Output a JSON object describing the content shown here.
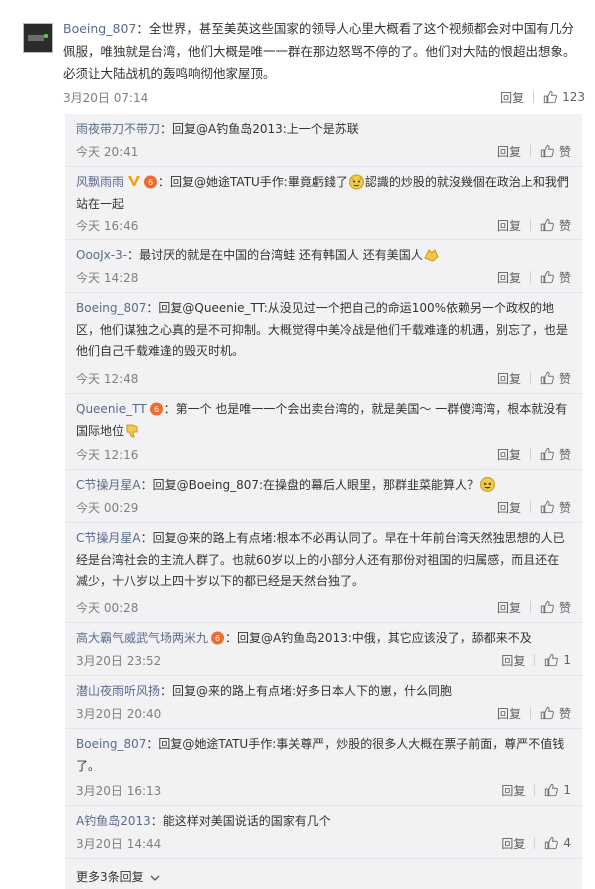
{
  "main_comment": {
    "username": "Boeing_807",
    "text": "：全世界，甚至美英这些国家的领导人心里大概看了这个视频都会对中国有几分佩服，唯独就是台湾，他们大概是唯一一群在那边怒骂不停的了。他们对大陆的恨超出想象。必须让大陆战机的轰鸣响彻他家屋顶。",
    "time": "3月20日 07:14",
    "reply_label": "回复",
    "like_count": "123"
  },
  "replies": [
    {
      "username": "雨夜带刀不带刀",
      "text": "：回复@A钓鱼岛2013:上一个是苏联",
      "time": "今天 20:41",
      "reply_label": "回复",
      "like_label": "赞"
    },
    {
      "username": "风飘雨雨",
      "text": "：回复@她途TATU手作:畢竟虧錢了",
      "text2": "認識的炒股的就沒幾個在政治上和我們站在一起",
      "time": "今天 16:46",
      "reply_label": "回复",
      "like_label": "赞"
    },
    {
      "username": "OooJx-3-",
      "text": "：最讨厌的就是在中国的台湾蛙 还有韩国人 还有美国人",
      "time": "今天 14:28",
      "reply_label": "回复",
      "like_label": "赞"
    },
    {
      "username": "Boeing_807",
      "text": "：回复@Queenie_TT:从没见过一个把自己的命运100%依赖另一个政权的地区，他们谋独之心真的是不可抑制。大概觉得中美冷战是他们千载难逢的机遇，别忘了，也是他们自己千载难逢的毁灭时机。",
      "time": "今天 12:48",
      "reply_label": "回复",
      "like_label": "赞"
    },
    {
      "username": "Queenie_TT",
      "text": "：第一个 也是唯一一个会出卖台湾的，就是美国～ 一群傻湾湾，根本就没有国际地位",
      "time": "今天 12:16",
      "reply_label": "回复",
      "like_label": "赞"
    },
    {
      "username": "C节操月星A",
      "text": "：回复@Boeing_807:在操盘的幕后人眼里，那群韭菜能算人？",
      "time": "今天 00:29",
      "reply_label": "回复",
      "like_label": "赞"
    },
    {
      "username": "C节操月星A",
      "text": "：回复@来的路上有点堵:根本不必再认同了。早在十年前台湾天然独思想的人已经是台湾社会的主流人群了。也就60岁以上的小部分人还有那份对祖国的归属感，而且还在减少，十八岁以上四十岁以下的都已经是天然台独了。",
      "time": "今天 00:28",
      "reply_label": "回复",
      "like_label": "赞"
    },
    {
      "username": "高大霸气威武气场两米九",
      "text": "：回复@A钓鱼岛2013:中俄，其它应该没了，舔都来不及",
      "time": "3月20日 23:52",
      "reply_label": "回复",
      "like_label": "1"
    },
    {
      "username": "潜山夜雨听风扬",
      "text": "：回复@来的路上有点堵:好多日本人下的崽，什么同胞",
      "time": "3月20日 20:40",
      "reply_label": "回复",
      "like_label": "赞"
    },
    {
      "username": "Boeing_807",
      "text": "：回复@她途TATU手作:事关尊严，炒股的很多人大概在票子前面，尊严不值钱了。",
      "time": "3月20日 16:13",
      "reply_label": "回复",
      "like_label": "1"
    },
    {
      "username": "A钓鱼岛2013",
      "text": "：能这样对美国说话的国家有几个",
      "time": "3月20日 14:44",
      "reply_label": "回复",
      "like_label": "4"
    }
  ],
  "more_replies": "更多3条回复",
  "icons": {
    "like": "thumbs-up-icon",
    "vip": "vip-v-icon",
    "badge": "member-badge-icon",
    "expand": "chevron-down-icon"
  },
  "colors": {
    "username": "#5a6b8c",
    "reply_bg": "#f2f2f5",
    "meta": "#808080"
  }
}
